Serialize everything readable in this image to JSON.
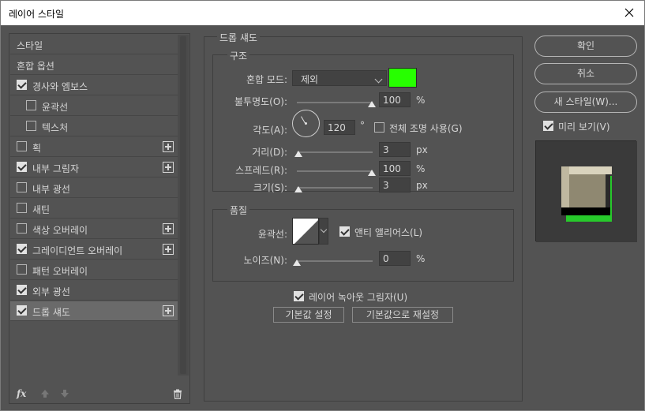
{
  "window": {
    "title": "레이어 스타일"
  },
  "styles_list": {
    "items": [
      {
        "label": "스타일",
        "checkbox": false,
        "checked": false,
        "plus": false,
        "indent": 0,
        "selected": false
      },
      {
        "label": "혼합 옵션",
        "checkbox": false,
        "checked": false,
        "plus": false,
        "indent": 0,
        "selected": false
      },
      {
        "label": "경사와 엠보스",
        "checkbox": true,
        "checked": true,
        "plus": false,
        "indent": 0,
        "selected": false
      },
      {
        "label": "윤곽선",
        "checkbox": true,
        "checked": false,
        "plus": false,
        "indent": 1,
        "selected": false
      },
      {
        "label": "텍스처",
        "checkbox": true,
        "checked": false,
        "plus": false,
        "indent": 1,
        "selected": false
      },
      {
        "label": "획",
        "checkbox": true,
        "checked": false,
        "plus": true,
        "indent": 0,
        "selected": false
      },
      {
        "label": "내부 그림자",
        "checkbox": true,
        "checked": true,
        "plus": true,
        "indent": 0,
        "selected": false
      },
      {
        "label": "내부 광선",
        "checkbox": true,
        "checked": false,
        "plus": false,
        "indent": 0,
        "selected": false
      },
      {
        "label": "새틴",
        "checkbox": true,
        "checked": false,
        "plus": false,
        "indent": 0,
        "selected": false
      },
      {
        "label": "색상 오버레이",
        "checkbox": true,
        "checked": false,
        "plus": true,
        "indent": 0,
        "selected": false
      },
      {
        "label": "그레이디언트 오버레이",
        "checkbox": true,
        "checked": true,
        "plus": true,
        "indent": 0,
        "selected": false
      },
      {
        "label": "패턴 오버레이",
        "checkbox": true,
        "checked": false,
        "plus": false,
        "indent": 0,
        "selected": false
      },
      {
        "label": "외부 광선",
        "checkbox": true,
        "checked": true,
        "plus": false,
        "indent": 0,
        "selected": false
      },
      {
        "label": "드롭 섀도",
        "checkbox": true,
        "checked": true,
        "plus": true,
        "indent": 0,
        "selected": true
      }
    ],
    "fx_label": "fx"
  },
  "drop_shadow": {
    "heading": "드롭 섀도",
    "structure": {
      "heading": "구조",
      "blend_mode_label": "혼합 모드:",
      "blend_mode_value": "제외",
      "shadow_color": "#27ff00",
      "opacity_label": "불투명도(O):",
      "opacity_value": "100",
      "opacity_level": 100,
      "opacity_unit": "%",
      "angle_label": "각도(A):",
      "angle_value": "120",
      "angle_unit": "°",
      "global_light_label": "전체 조명 사용(G)",
      "global_light_checked": false,
      "distance_label": "거리(D):",
      "distance_value": "3",
      "distance_unit": "px",
      "spread_label": "스프레드(R):",
      "spread_value": "100",
      "spread_level": 100,
      "spread_unit": "%",
      "size_label": "크기(S):",
      "size_value": "3",
      "size_unit": "px"
    },
    "quality": {
      "heading": "품질",
      "contour_label": "윤곽선:",
      "anti_alias_label": "앤티 앨리어스(L)",
      "anti_alias_checked": true,
      "noise_label": "노이즈(N):",
      "noise_value": "0",
      "noise_level": 0,
      "noise_unit": "%"
    },
    "knockout_label": "레이어 녹아웃 그림자(U)",
    "knockout_checked": true,
    "make_default_label": "기본값 설정",
    "reset_default_label": "기본값으로 재설정"
  },
  "actions": {
    "ok_label": "확인",
    "cancel_label": "취소",
    "new_style_label": "새 스타일(W)...",
    "preview_label": "미리 보기(V)",
    "preview_checked": true
  }
}
